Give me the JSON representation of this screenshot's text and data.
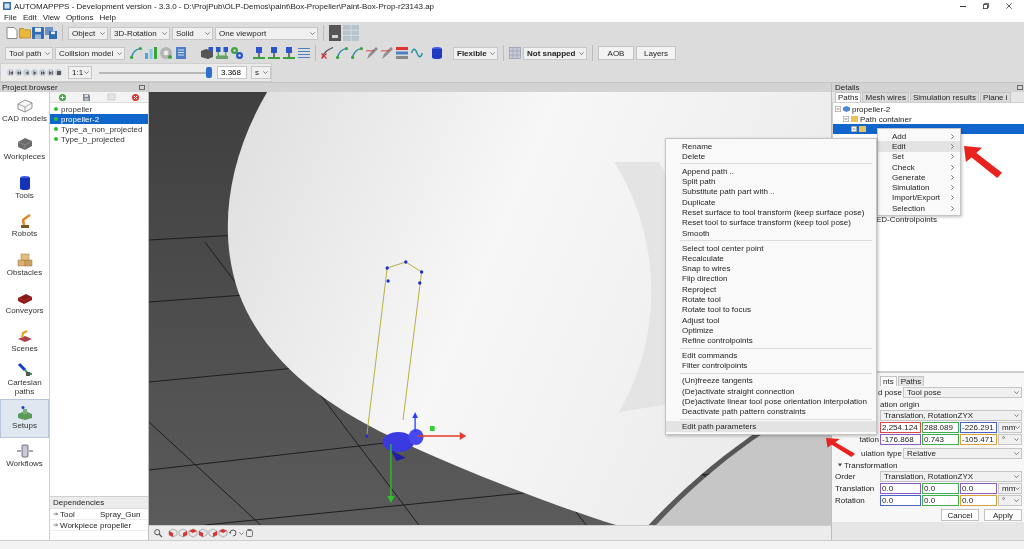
{
  "window": {
    "title": "AUTOMAPPPS - Development version - 3.3.0 - D:\\ProjPub\\OLP-Demos\\paint\\Box-Propeller\\Paint-Box-Prop-r23143.ap"
  },
  "menu_bar": [
    "File",
    "Edit",
    "View",
    "Options",
    "Help"
  ],
  "toolbar": {
    "view_dropdowns": [
      "Object",
      "3D-Rotation",
      "Solid",
      "One viewport"
    ],
    "mode_dropdowns": [
      "Tool path",
      "Collision model"
    ],
    "flexibility": "Flexible",
    "snapping": "Not snapped",
    "buttons": [
      "AOB",
      "Layers"
    ],
    "playback": {
      "scale": "1:1",
      "time_slider": {
        "level": 1
      },
      "time": "3.368",
      "unit": "s"
    }
  },
  "project_browser": {
    "title": "Project browser",
    "categories": [
      {
        "label": "CAD models",
        "selected": false
      },
      {
        "label": "Workpieces",
        "selected": false
      },
      {
        "label": "Tools",
        "selected": false
      },
      {
        "label": "Robots",
        "selected": false
      },
      {
        "label": "Obstacles",
        "selected": false
      },
      {
        "label": "Conveyors",
        "selected": false
      },
      {
        "label": "Scenes",
        "selected": false
      },
      {
        "label": "Cartesian paths",
        "selected": false
      },
      {
        "label": "Setups",
        "selected": true
      },
      {
        "label": "Workflows",
        "selected": false
      }
    ],
    "items": [
      {
        "label": "propeller",
        "selected": false
      },
      {
        "label": "propeller-2",
        "selected": true
      },
      {
        "label": "Type_a_non_projected",
        "selected": false
      },
      {
        "label": "Type_b_projected",
        "selected": false
      }
    ],
    "dependencies": {
      "title": "Dependencies",
      "rows": [
        {
          "name": "Tool",
          "value": "Spray_Gun"
        },
        {
          "name": "Workpiece",
          "value": "propeller"
        }
      ]
    }
  },
  "details": {
    "title": "Details",
    "tabs": [
      {
        "label": "Paths",
        "selected": true
      },
      {
        "label": "Mesh wires",
        "selected": false
      },
      {
        "label": "Simulation results",
        "selected": false
      },
      {
        "label": "Plane i",
        "selected": false
      }
    ],
    "tree": [
      {
        "label": "propeller-2",
        "selected": false,
        "expanded": true,
        "children": [
          {
            "label": "Path container",
            "selected": false,
            "expanded": true,
            "children": [
              {
                "selected": true,
                "expanded": true,
                "children": [
                  {
                    "label": "ED-Controlpoints",
                    "selected": false
                  }
                ]
              }
            ]
          }
        ]
      }
    ],
    "form": {
      "tabs": [
        {
          "label": "nts",
          "selected": true
        },
        {
          "label": "Paths",
          "selected": false
        }
      ],
      "reference": {
        "label": "d pose",
        "value": "Tool pose"
      },
      "origin": {
        "title": "ation origin",
        "order": "Translation, RotationZYX",
        "rows": [
          {
            "fields": [
              {
                "value": "2,254.124",
                "color": "#d94848"
              },
              {
                "value": "288.089",
                "color": "#3fae4f"
              },
              {
                "value": "-226.291",
                "color": "#4a63c9"
              }
            ],
            "unit": "mm"
          },
          {
            "label": "tation",
            "fields": [
              {
                "value": "-176.868",
                "color": "#8a5cc4"
              },
              {
                "value": "0.743",
                "color": "#3fae4f"
              },
              {
                "value": "-105.471",
                "color": "#d9a13b"
              }
            ],
            "unit": "°"
          }
        ]
      },
      "interpolation": {
        "label": "ulation type",
        "value": "Relative"
      },
      "transformation": {
        "title": "Transformation",
        "expanded": true,
        "order_label": "Order",
        "order": "Translation, RotationZYX",
        "rows": [
          {
            "label": "Translation",
            "fields": [
              {
                "value": "0.0",
                "color": "#8a5cc4"
              },
              {
                "value": "0.0",
                "color": "#3fae4f"
              },
              {
                "value": "0.0",
                "color": "#8a5cc4"
              }
            ],
            "unit": "mm"
          },
          {
            "label": "Rotation",
            "fields": [
              {
                "value": "0.0",
                "color": "#4a63c9"
              },
              {
                "value": "0.0",
                "color": "#3fae4f"
              },
              {
                "value": "0.0",
                "color": "#d9a13b"
              }
            ],
            "unit": "°"
          }
        ]
      },
      "buttons": [
        "Cancel",
        "Apply"
      ]
    }
  },
  "tree_menu": {
    "items": [
      {
        "label": "Add",
        "highlighted": false,
        "submenu": true
      },
      {
        "label": "Edit",
        "highlighted": true,
        "submenu": true
      },
      {
        "label": "Set",
        "highlighted": false,
        "submenu": true
      },
      {
        "label": "Check",
        "highlighted": false,
        "submenu": true
      },
      {
        "label": "Generate",
        "highlighted": false,
        "submenu": true
      },
      {
        "label": "Simulation",
        "highlighted": false,
        "submenu": true
      },
      {
        "label": "Import/Export",
        "highlighted": false,
        "submenu": true
      },
      {
        "label": "Selection",
        "highlighted": false,
        "submenu": true
      }
    ]
  },
  "edit_submenu": {
    "groups": [
      [
        {
          "label": "Rename",
          "highlighted": false
        },
        {
          "label": "Delete",
          "highlighted": false
        }
      ],
      [
        {
          "label": "Append path ..",
          "highlighted": false
        },
        {
          "label": "Split path",
          "highlighted": false
        },
        {
          "label": "Substitute path part with ..",
          "highlighted": false
        },
        {
          "label": "Duplicate",
          "highlighted": false
        },
        {
          "label": "Reset surface to tool transform (keep surface pose)",
          "highlighted": false
        },
        {
          "label": "Reset tool to surface transform (keep tool pose)",
          "highlighted": false
        },
        {
          "label": "Smooth",
          "highlighted": false
        }
      ],
      [
        {
          "label": "Select tool center point",
          "highlighted": false
        },
        {
          "label": "Recalculate",
          "highlighted": false
        },
        {
          "label": "Snap to wires",
          "highlighted": false
        },
        {
          "label": "Flip direction",
          "highlighted": false
        },
        {
          "label": "Reproject",
          "highlighted": false
        },
        {
          "label": "Rotate tool",
          "highlighted": false
        },
        {
          "label": "Rotate tool to focus",
          "highlighted": false
        },
        {
          "label": "Adjust tool",
          "highlighted": false
        },
        {
          "label": "Optimize",
          "highlighted": false
        },
        {
          "label": "Refine controlpoints",
          "highlighted": false
        }
      ],
      [
        {
          "label": "Edit commands",
          "highlighted": false
        },
        {
          "label": "Filter controlpoints",
          "highlighted": false
        }
      ],
      [
        {
          "label": "(Un)freeze tangents",
          "highlighted": false
        },
        {
          "label": "(De)activate straight connection",
          "highlighted": false
        },
        {
          "label": "(De)activate linear tool pose orientation interpolation",
          "highlighted": false
        },
        {
          "label": "Deactivate path pattern constraints",
          "highlighted": false
        }
      ],
      [
        {
          "label": "Edit path parameters",
          "highlighted": true
        }
      ]
    ]
  }
}
